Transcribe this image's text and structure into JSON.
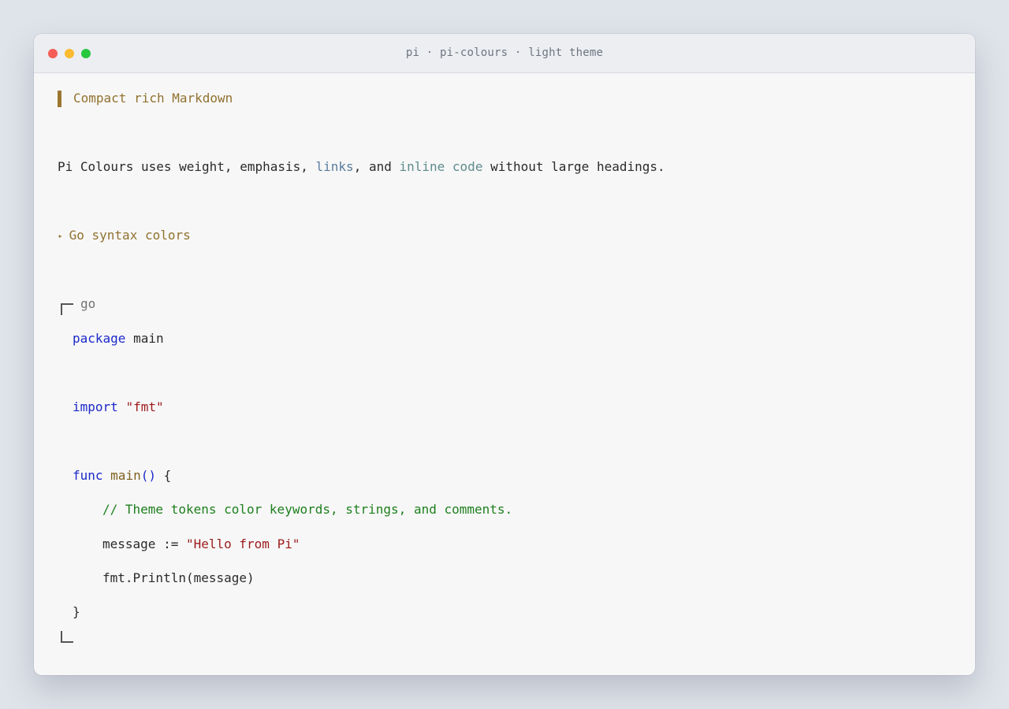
{
  "window": {
    "title": "pi · pi-colours · light theme"
  },
  "doc": {
    "quote_heading": "Compact rich Markdown",
    "paragraph": {
      "before_links": "Pi Colours uses weight, emphasis, ",
      "links": "links",
      "between": ", and ",
      "inline_code": "inline code",
      "after": " without large headings."
    },
    "list_heading": {
      "bullet": "‣",
      "label": "Go syntax colors"
    },
    "code_block": {
      "lang": "go",
      "line1_kw": "package",
      "line1_rest": " main",
      "line2_kw": "import",
      "line2_str": "\"fmt\"",
      "line3_kw": "func",
      "line3_fn": "main",
      "line3_parens": "()",
      "line3_brace": " {",
      "line4_comment": "// Theme tokens color keywords, strings, and comments.",
      "line5_plain": "message := ",
      "line5_str": "\"Hello from Pi\"",
      "line6_plain": "fmt.Println(message)",
      "line7_plain": "}"
    }
  },
  "colors": {
    "heading": "#91722f",
    "link": "#5a7d9f",
    "inline_code": "#5f8b8d",
    "keyword": "#1c29c9",
    "string": "#9c1b1b",
    "comment": "#1e7f1e"
  }
}
